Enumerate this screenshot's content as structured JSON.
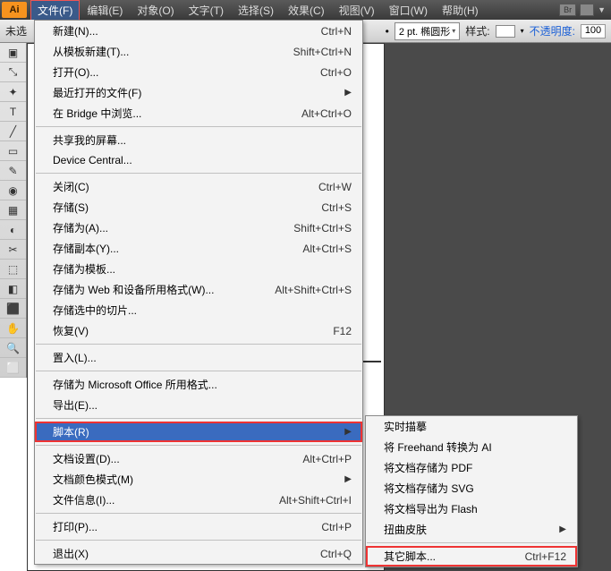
{
  "menubar": {
    "logo": "Ai",
    "items": [
      "文件(F)",
      "编辑(E)",
      "对象(O)",
      "文字(T)",
      "选择(S)",
      "效果(C)",
      "视图(V)",
      "窗口(W)",
      "帮助(H)"
    ],
    "active_index": 0,
    "br": "Br"
  },
  "toolbar2": {
    "left_text": "未选",
    "stroke_label": "2 pt. 椭圆形",
    "style_label": "样式:",
    "opacity_label": "不透明度:",
    "opacity_value": "100"
  },
  "toolbox_glyphs": [
    "▣",
    "⤡",
    "✦",
    "T",
    "╱",
    "▭",
    "✎",
    "◉",
    "▦",
    "◐",
    "✂",
    "⬚",
    "◧",
    "⬛",
    "✋",
    "🔍",
    "⬜"
  ],
  "main_menu": [
    {
      "label": "新建(N)...",
      "shortcut": "Ctrl+N"
    },
    {
      "label": "从模板新建(T)...",
      "shortcut": "Shift+Ctrl+N"
    },
    {
      "label": "打开(O)...",
      "shortcut": "Ctrl+O"
    },
    {
      "label": "最近打开的文件(F)",
      "submenu": true
    },
    {
      "label": "在 Bridge 中浏览...",
      "shortcut": "Alt+Ctrl+O"
    },
    {
      "sep": true
    },
    {
      "label": "共享我的屏幕..."
    },
    {
      "label": "Device Central..."
    },
    {
      "sep": true
    },
    {
      "label": "关闭(C)",
      "shortcut": "Ctrl+W"
    },
    {
      "label": "存储(S)",
      "shortcut": "Ctrl+S"
    },
    {
      "label": "存储为(A)...",
      "shortcut": "Shift+Ctrl+S"
    },
    {
      "label": "存储副本(Y)...",
      "shortcut": "Alt+Ctrl+S"
    },
    {
      "label": "存储为模板..."
    },
    {
      "label": "存储为 Web 和设备所用格式(W)...",
      "shortcut": "Alt+Shift+Ctrl+S"
    },
    {
      "label": "存储选中的切片..."
    },
    {
      "label": "恢复(V)",
      "shortcut": "F12"
    },
    {
      "sep": true
    },
    {
      "label": "置入(L)..."
    },
    {
      "sep": true
    },
    {
      "label": "存储为 Microsoft Office 所用格式..."
    },
    {
      "label": "导出(E)..."
    },
    {
      "sep": true
    },
    {
      "label": "脚本(R)",
      "submenu": true,
      "boxed": true,
      "highlight": true
    },
    {
      "sep": true
    },
    {
      "label": "文档设置(D)...",
      "shortcut": "Alt+Ctrl+P"
    },
    {
      "label": "文档颜色模式(M)",
      "submenu": true
    },
    {
      "label": "文件信息(I)...",
      "shortcut": "Alt+Shift+Ctrl+I"
    },
    {
      "sep": true
    },
    {
      "label": "打印(P)...",
      "shortcut": "Ctrl+P"
    },
    {
      "sep": true
    },
    {
      "label": "退出(X)",
      "shortcut": "Ctrl+Q"
    }
  ],
  "sub_menu": [
    {
      "label": "实时描摹"
    },
    {
      "label": "将 Freehand 转换为 AI"
    },
    {
      "label": "将文档存储为 PDF"
    },
    {
      "label": "将文档存储为 SVG"
    },
    {
      "label": "将文档导出为 Flash"
    },
    {
      "label": "扭曲皮肤",
      "submenu": true
    },
    {
      "sep": true
    },
    {
      "label": "其它脚本...",
      "shortcut": "Ctrl+F12",
      "boxed": true
    }
  ]
}
